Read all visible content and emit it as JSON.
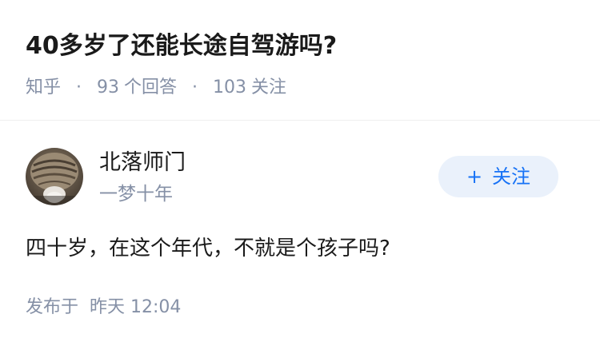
{
  "question": {
    "title": "40多岁了还能长途自驾游吗?",
    "source": "知乎",
    "separator": "·",
    "answer_count": "93",
    "answer_label": "个回答",
    "follower_count": "103",
    "follower_label": "关注"
  },
  "answer": {
    "author": {
      "name": "北落师门",
      "bio": "一梦十年",
      "avatar_icon": "cat-photo-avatar"
    },
    "follow_button": {
      "icon": "plus-icon",
      "label": "关注",
      "color": "#1772f6",
      "background": "#eaf1fb"
    },
    "content": "四十岁，在这个年代，不就是个孩子吗?",
    "published_label": "发布于",
    "published_time": "昨天 12:04"
  },
  "colors": {
    "text_primary": "#1a1a1a",
    "text_secondary": "#8590a6",
    "accent": "#1772f6"
  }
}
